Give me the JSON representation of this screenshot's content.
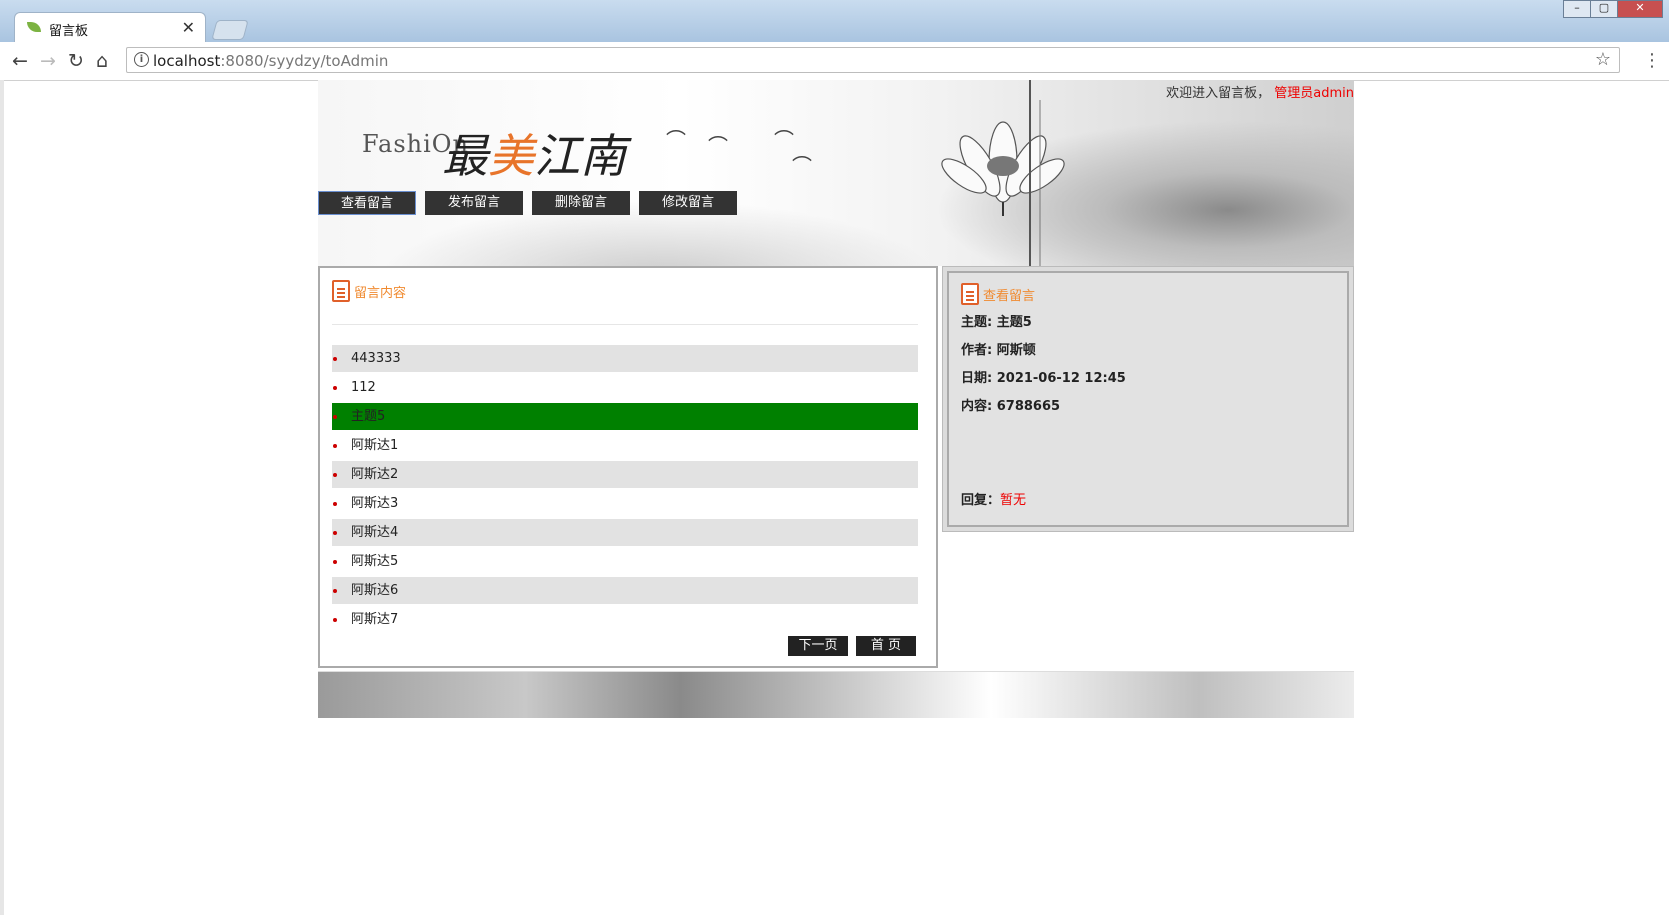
{
  "browser": {
    "tab_title": "留言板",
    "url_host": "localhost",
    "url_rest": ":8080/syydzy/toAdmin"
  },
  "header": {
    "welcome_text": "欢迎进入留言板，",
    "admin_text": "管理员admin",
    "logo_en": "FashiOn",
    "logo_cn_1": "最",
    "logo_cn_2": "美",
    "logo_cn_3": "江南"
  },
  "nav": {
    "view": "查看留言",
    "publish": "发布留言",
    "delete": "删除留言",
    "modify": "修改留言"
  },
  "left_panel": {
    "title": "留言内容",
    "items": [
      {
        "text": "443333",
        "state": "gray"
      },
      {
        "text": "112",
        "state": "white"
      },
      {
        "text": "主题5",
        "state": "selected"
      },
      {
        "text": "阿斯达1",
        "state": "white"
      },
      {
        "text": "阿斯达2",
        "state": "gray"
      },
      {
        "text": "阿斯达3",
        "state": "white"
      },
      {
        "text": "阿斯达4",
        "state": "gray"
      },
      {
        "text": "阿斯达5",
        "state": "white"
      },
      {
        "text": "阿斯达6",
        "state": "gray"
      },
      {
        "text": "阿斯达7",
        "state": "white"
      }
    ],
    "next_page": "下一页",
    "first_page": "首 页"
  },
  "right_panel": {
    "title": "查看留言",
    "subject_label": "主题:",
    "subject": "主题5",
    "author_label": "作者:",
    "author": "阿斯顿",
    "date_label": "日期:",
    "date": "2021-06-12 12:45",
    "content_label": "内容:",
    "content": "6788665",
    "reply_label": "回复：",
    "reply": "暂无"
  },
  "colors": {
    "selected_row": "#008000",
    "gray_row": "#e2e2e2",
    "accent_orange": "#f08a30",
    "admin_red": "#ee0000"
  }
}
